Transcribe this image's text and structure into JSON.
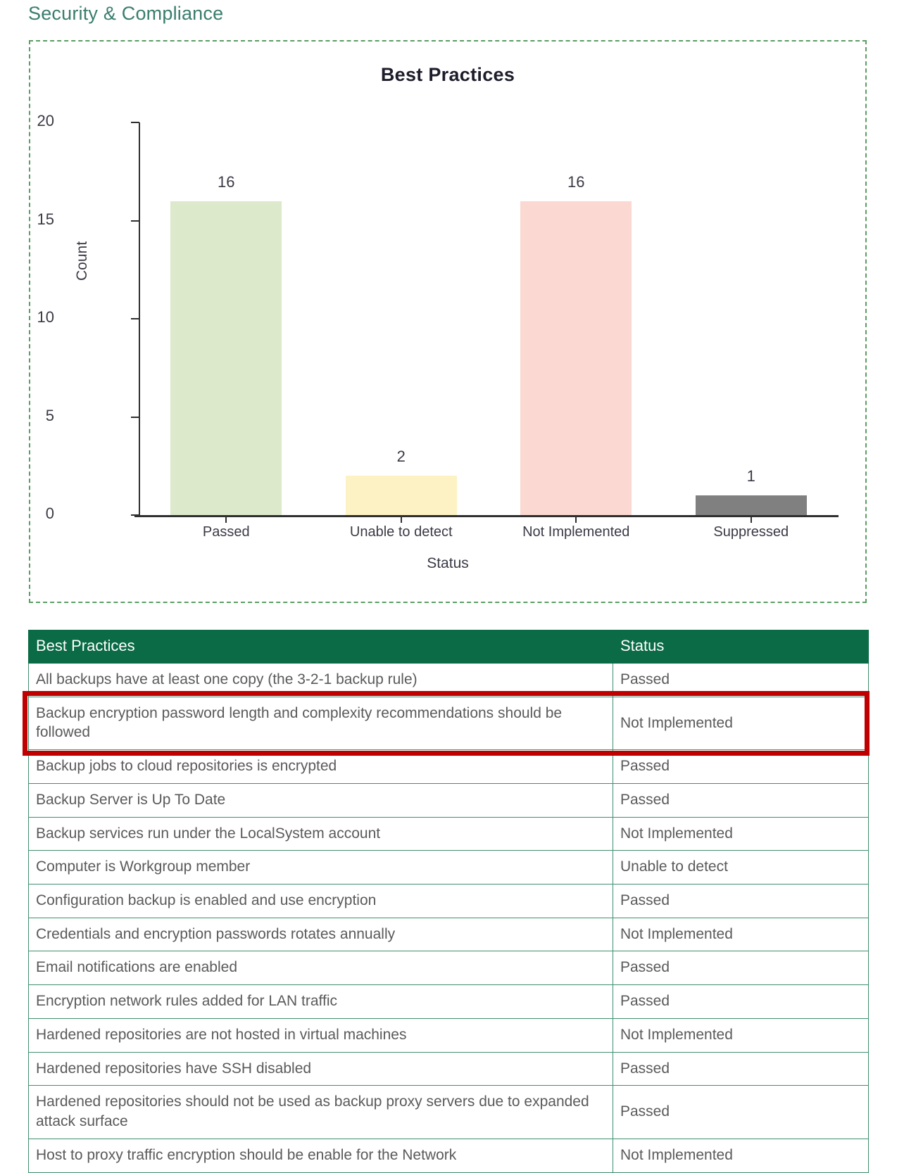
{
  "page": {
    "title": "Security & Compliance",
    "title_color": "#3a7d6d"
  },
  "chart_panel": {
    "border_color": "#5a9e62"
  },
  "chart_data": {
    "type": "bar",
    "title": "Best Practices",
    "xlabel": "Status",
    "ylabel": "Count",
    "categories": [
      "Passed",
      "Unable to detect",
      "Not Implemented",
      "Suppressed"
    ],
    "values": [
      16,
      2,
      16,
      1
    ],
    "value_labels": [
      "16",
      "2",
      "16",
      "1"
    ],
    "ylim": [
      0,
      20
    ],
    "yticks": [
      0,
      5,
      10,
      15,
      20
    ],
    "ytick_labels": [
      "0",
      "5",
      "10",
      "15",
      "20"
    ],
    "grid": false,
    "legend": "none",
    "bar_colors": [
      "#dceacb",
      "#fcf2c4",
      "#fbd9d2",
      "#808080"
    ]
  },
  "table": {
    "headers": [
      "Best Practices",
      "Status"
    ],
    "header_bg": "#0a6b46",
    "highlight_row_index": 1,
    "highlight_color": "#c00000",
    "status_colors": {
      "Passed": "#d8ecc8",
      "Not Implemented": "#fadbd5",
      "Unable to detect": "#fbf0bd",
      "Suppressed": "#d9d9d9"
    },
    "rows": [
      {
        "practice": "All backups have at least one copy (the 3-2-1 backup rule)",
        "status": "Passed"
      },
      {
        "practice": "Backup encryption password length and complexity recommendations should be followed",
        "status": "Not Implemented"
      },
      {
        "practice": "Backup jobs to cloud repositories is encrypted",
        "status": "Passed"
      },
      {
        "practice": "Backup Server is Up To Date",
        "status": "Passed"
      },
      {
        "practice": "Backup services run under the LocalSystem account",
        "status": "Not Implemented"
      },
      {
        "practice": "Computer is Workgroup member",
        "status": "Unable to detect"
      },
      {
        "practice": "Configuration backup is enabled and use encryption",
        "status": "Passed"
      },
      {
        "practice": "Credentials and encryption passwords rotates annually",
        "status": "Not Implemented"
      },
      {
        "practice": "Email notifications are enabled",
        "status": "Passed"
      },
      {
        "practice": "Encryption network rules added for LAN traffic",
        "status": "Passed"
      },
      {
        "practice": "Hardened repositories are not hosted in virtual machines",
        "status": "Not Implemented"
      },
      {
        "practice": "Hardened repositories have SSH disabled",
        "status": "Passed"
      },
      {
        "practice": "Hardened repositories should not be used as backup proxy servers due to expanded attack surface",
        "status": "Passed"
      },
      {
        "practice": "Host to proxy traffic encryption should be enable for the Network",
        "status": "Not Implemented"
      }
    ]
  }
}
